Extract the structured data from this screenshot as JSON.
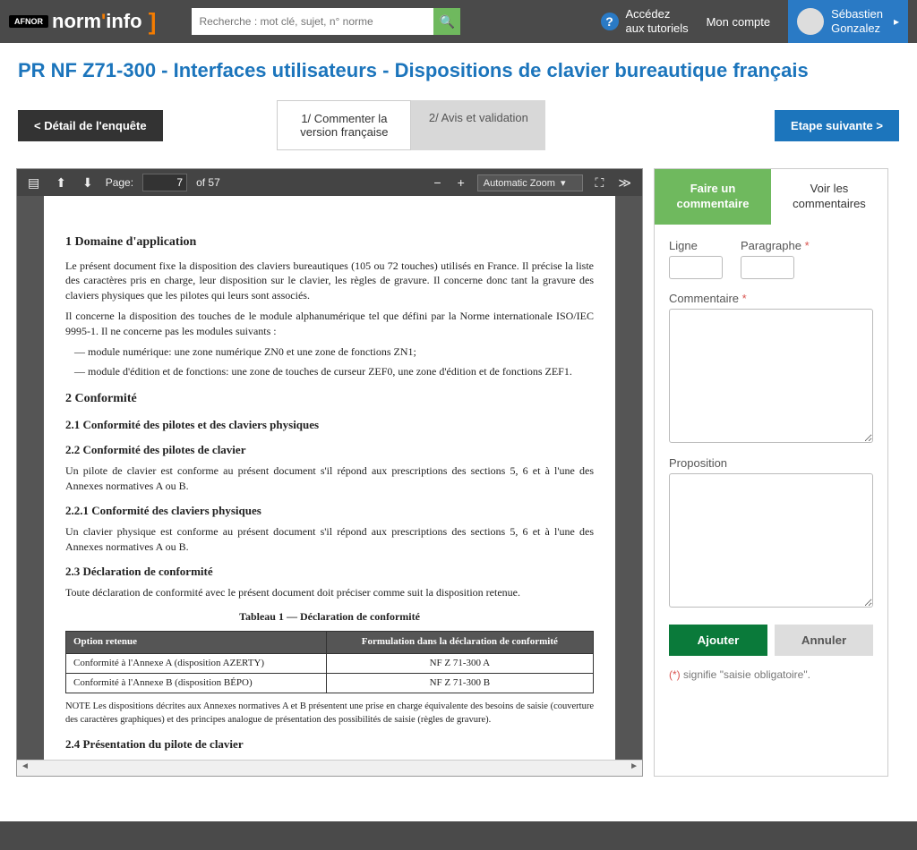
{
  "header": {
    "logo_afnor": "AFNOR",
    "logo_norm": "norm",
    "logo_info": "info",
    "search_placeholder": "Recherche : mot clé, sujet, n° norme",
    "tutorials": "Accédez\naux tutoriels",
    "account": "Mon compte",
    "user_first": "Sébastien",
    "user_last": "Gonzalez"
  },
  "title": "PR NF Z71-300 - Interfaces utilisateurs - Dispositions de clavier bureautique français",
  "nav": {
    "back": "< Détail de l'enquête",
    "tab1": "1/ Commenter la version française",
    "tab2": "2/ Avis et validation",
    "next": "Etape suivante >"
  },
  "viewer": {
    "page_label": "Page:",
    "page_current": "7",
    "page_total": "of 57",
    "zoom": "Automatic Zoom"
  },
  "doc": {
    "h1": "1   Domaine d'application",
    "p1": "Le présent document fixe la disposition des claviers bureautiques (105 ou 72 touches) utilisés en France. Il précise la liste des caractères pris en charge, leur disposition sur le clavier, les règles de gravure. Il concerne donc tant la gravure des claviers physiques que les pilotes qui leurs sont associés.",
    "p2": "Il concerne la disposition des touches de le module alphanumérique tel que défini par la Norme internationale ISO/IEC 9995-1. Il ne concerne pas les modules suivants :",
    "li1": "—   module numérique: une zone numérique ZN0 et une zone de fonctions ZN1;",
    "li2": "—   module d'édition et de fonctions: une zone de touches de curseur ZEF0, une zone d'édition et de fonctions ZEF1.",
    "h2": "2   Conformité",
    "h21": "2.1   Conformité des pilotes et des claviers physiques",
    "h22": "2.2   Conformité des pilotes de clavier",
    "p3": "Un pilote de clavier est conforme au présent document s'il répond aux prescriptions des sections 5, 6 et à l'une des Annexes normatives A ou B.",
    "h221": "2.2.1   Conformité des claviers physiques",
    "p4": "Un clavier physique est conforme au présent document s'il répond aux prescriptions des sections 5, 6 et à l'une des Annexes normatives A ou B.",
    "h23": "2.3   Déclaration de conformité",
    "p5": "Toute déclaration de conformité avec le présent document doit préciser comme suit la disposition retenue.",
    "table_caption": "Tableau 1 — Déclaration de conformité",
    "th1": "Option retenue",
    "th2": "Formulation dans la déclaration de conformité",
    "r1c1": "Conformité à l'Annexe A (disposition AZERTY)",
    "r1c2": "NF Z 71-300 A",
    "r2c1": "Conformité à l'Annexe B (disposition BÉPO)",
    "r2c2": "NF Z 71-300 B",
    "note": "NOTE     Les dispositions décrites aux Annexes normatives A et B présentent une prise en charge équivalente des besoins de saisie (couverture des caractères graphiques) et des principes analogue de présentation des possibilités de saisie (règles de gravure).",
    "h24": "2.4   Présentation du pilote de clavier"
  },
  "side": {
    "tab_make": "Faire un commentaire",
    "tab_view": "Voir les commentaires",
    "ligne": "Ligne",
    "para": "Paragraphe",
    "comment": "Commentaire",
    "prop": "Proposition",
    "add": "Ajouter",
    "cancel": "Annuler",
    "note_paren": "(*)",
    "note_rest": " signifie \"saisie obligatoire\"."
  }
}
